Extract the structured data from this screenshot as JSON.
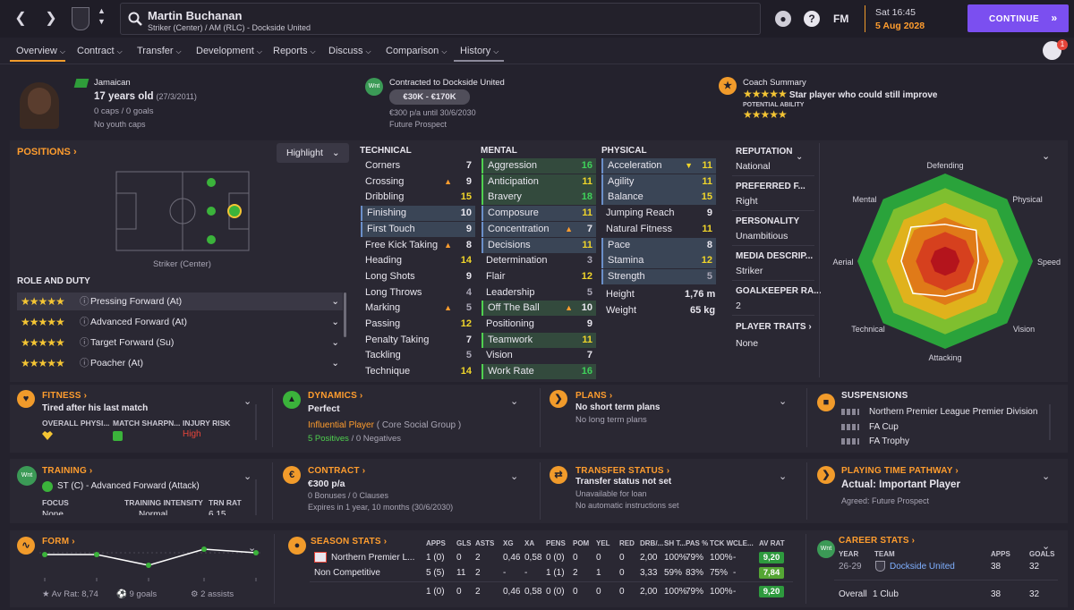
{
  "player": {
    "name": "Martin Buchanan",
    "subtitle": "Striker (Center) / AM (RLC) - Dockside United",
    "nationality": "Jamaican",
    "age": "17 years old",
    "dob": "(27/3/2011)",
    "caps": "0 caps / 0 goals",
    "youth_caps": "No youth caps"
  },
  "game": {
    "fm_label": "FM",
    "time": "Sat 16:45",
    "date": "5 Aug 2028",
    "continue_label": "CONTINUE",
    "help_label": "?"
  },
  "tabs": [
    {
      "label": "Overview"
    },
    {
      "label": "Contract"
    },
    {
      "label": "Transfer"
    },
    {
      "label": "Development"
    },
    {
      "label": "Reports"
    },
    {
      "label": "Discuss"
    },
    {
      "label": "Comparison"
    },
    {
      "label": "History"
    }
  ],
  "contract_header": {
    "title": "Contracted to Dockside United",
    "value_range": "€30K - €170K",
    "wage_line": "€300 p/a until 30/6/2030",
    "prospect": "Future Prospect",
    "badge": "Wnt"
  },
  "coach": {
    "title": "Coach Summary",
    "stars": "★★★★★",
    "summary": "Star player who could still improve",
    "potential_label": "POTENTIAL ABILITY",
    "potential_stars": "★★★★★"
  },
  "positions": {
    "title": "POSITIONS",
    "highlight_label": "Highlight",
    "pitch_caption": "Striker (Center)",
    "role_title": "ROLE AND DUTY",
    "roles": [
      {
        "stars": "★★★★★",
        "label": "Pressing Forward (At)"
      },
      {
        "stars": "★★★★★",
        "label": "Advanced Forward (At)"
      },
      {
        "stars": "★★★★★",
        "label": "Target Forward (Su)"
      },
      {
        "stars": "★★★★★",
        "label": "Poacher (At)"
      }
    ]
  },
  "technical": {
    "title": "TECHNICAL",
    "rows": [
      {
        "name": "Corners",
        "value": "7"
      },
      {
        "name": "Crossing",
        "value": "9"
      },
      {
        "name": "Dribbling",
        "value": "15"
      },
      {
        "name": "Finishing",
        "value": "10"
      },
      {
        "name": "First Touch",
        "value": "9"
      },
      {
        "name": "Free Kick Taking",
        "value": "8"
      },
      {
        "name": "Heading",
        "value": "14"
      },
      {
        "name": "Long Shots",
        "value": "9"
      },
      {
        "name": "Long Throws",
        "value": "4"
      },
      {
        "name": "Marking",
        "value": "5"
      },
      {
        "name": "Passing",
        "value": "12"
      },
      {
        "name": "Penalty Taking",
        "value": "7"
      },
      {
        "name": "Tackling",
        "value": "5"
      },
      {
        "name": "Technique",
        "value": "14"
      }
    ]
  },
  "mental": {
    "title": "MENTAL",
    "rows": [
      {
        "name": "Aggression",
        "value": "16"
      },
      {
        "name": "Anticipation",
        "value": "11"
      },
      {
        "name": "Bravery",
        "value": "18"
      },
      {
        "name": "Composure",
        "value": "11"
      },
      {
        "name": "Concentration",
        "value": "7"
      },
      {
        "name": "Decisions",
        "value": "11"
      },
      {
        "name": "Determination",
        "value": "3"
      },
      {
        "name": "Flair",
        "value": "12"
      },
      {
        "name": "Leadership",
        "value": "5"
      },
      {
        "name": "Off The Ball",
        "value": "10"
      },
      {
        "name": "Positioning",
        "value": "9"
      },
      {
        "name": "Teamwork",
        "value": "11"
      },
      {
        "name": "Vision",
        "value": "7"
      },
      {
        "name": "Work Rate",
        "value": "16"
      }
    ]
  },
  "physical": {
    "title": "PHYSICAL",
    "rows": [
      {
        "name": "Acceleration",
        "value": "11"
      },
      {
        "name": "Agility",
        "value": "11"
      },
      {
        "name": "Balance",
        "value": "15"
      },
      {
        "name": "Jumping Reach",
        "value": "9"
      },
      {
        "name": "Natural Fitness",
        "value": "11"
      },
      {
        "name": "Pace",
        "value": "8"
      },
      {
        "name": "Stamina",
        "value": "12"
      },
      {
        "name": "Strength",
        "value": "5"
      }
    ],
    "height_label": "Height",
    "height": "1,76 m",
    "weight_label": "Weight",
    "weight": "65 kg"
  },
  "info": {
    "reputation_label": "REPUTATION",
    "reputation": "National",
    "foot_label": "PREFERRED F...",
    "foot": "Right",
    "personality_label": "PERSONALITY",
    "personality": "Unambitious",
    "media_label": "MEDIA DESCRIP...",
    "media": "Striker",
    "gk_label": "GOALKEEPER RA...",
    "gk": "2",
    "traits_label": "PLAYER TRAITS",
    "traits": "None"
  },
  "radar": {
    "labels": [
      "Defending",
      "Physical",
      "Speed",
      "Vision",
      "Attacking",
      "Technical",
      "Aerial",
      "Mental"
    ],
    "values": [
      0.42,
      0.5,
      0.38,
      0.45,
      0.4,
      0.52,
      0.5,
      0.55
    ]
  },
  "fitness": {
    "title": "FITNESS",
    "status": "Tired after his last match",
    "col1": "OVERALL PHYSI...",
    "col2": "MATCH SHARPN...",
    "col3": "INJURY RISK",
    "injury": "High"
  },
  "dynamics": {
    "title": "DYNAMICS",
    "status": "Perfect",
    "group": "Influential Player",
    "group_suffix": "( Core Social Group )",
    "positives": "5 Positives",
    "negatives": "/ 0 Negatives"
  },
  "plans": {
    "title": "PLANS",
    "line1": "No short term plans",
    "line2": "No long term plans"
  },
  "suspensions": {
    "title": "SUSPENSIONS",
    "rows": [
      "Northern Premier League Premier Division",
      "FA Cup",
      "FA Trophy"
    ]
  },
  "training": {
    "title": "TRAINING",
    "role": "ST (C) - Advanced Forward (Attack)",
    "focus": "FOCUS",
    "intensity": "TRAINING INTENSITY",
    "trn": "TRN RAT",
    "focus_val": "None",
    "intensity_val": "Normal",
    "trn_val": "6.15"
  },
  "contract_card": {
    "title": "CONTRACT",
    "wage": "€300 p/a",
    "bonuses": "0 Bonuses / 0 Clauses",
    "expires": "Expires in 1 year, 10 months (30/6/2030)"
  },
  "transfer_status": {
    "title": "TRANSFER STATUS",
    "line1": "Transfer status not set",
    "line2": "Unavailable for loan",
    "line3": "No automatic instructions set"
  },
  "pathway": {
    "title": "PLAYING TIME PATHWAY",
    "actual": "Actual: Important Player",
    "agreed": "Agreed: Future Prospect"
  },
  "form": {
    "title": "FORM",
    "avg": "Av Rat: 8,74",
    "goals": "9 goals",
    "assists": "2 assists"
  },
  "season_stats": {
    "title": "SEASON STATS",
    "headers": [
      "APPS",
      "GLS",
      "ASTS",
      "XG",
      "XA",
      "PENS",
      "POM",
      "YEL",
      "RED",
      "DRB/...",
      "SH T...",
      "PAS %",
      "TCK W",
      "CLE...",
      "AV RAT"
    ],
    "rows": [
      {
        "comp": "Northern Premier L...",
        "cells": [
          "1 (0)",
          "0",
          "2",
          "0,46",
          "0,58",
          "0 (0)",
          "0",
          "0",
          "0",
          "2,00",
          "100%",
          "79%",
          "100%",
          "-",
          "9,20"
        ],
        "av_color": "#2e9a3e"
      },
      {
        "comp": "Non Competitive",
        "cells": [
          "5 (5)",
          "11",
          "2",
          "-",
          "-",
          "1 (1)",
          "2",
          "1",
          "0",
          "3,33",
          "59%",
          "83%",
          "75%",
          "-",
          "7,84"
        ],
        "av_color": "#55a634"
      },
      {
        "comp": "",
        "cells": [
          "1 (0)",
          "0",
          "2",
          "0,46",
          "0,58",
          "0 (0)",
          "0",
          "0",
          "0",
          "2,00",
          "100%",
          "79%",
          "100%",
          "-",
          "9,20"
        ],
        "av_color": "#2e9a3e"
      }
    ]
  },
  "career": {
    "title": "CAREER STATS",
    "year_h": "YEAR",
    "team_h": "TEAM",
    "apps_h": "APPS",
    "goals_h": "GOALS",
    "year": "26-29",
    "team": "Dockside United",
    "apps": "38",
    "goals": "32",
    "overall": "Overall",
    "clubs": "1 Club",
    "total_apps": "38",
    "total_goals": "32"
  },
  "notifications": {
    "count": "1"
  }
}
